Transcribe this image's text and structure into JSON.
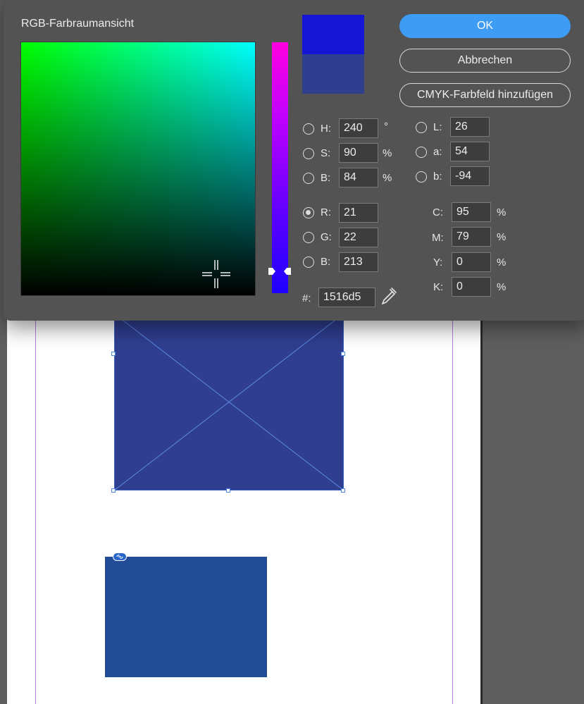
{
  "dialog": {
    "title": "RGB-Farbraumansicht",
    "ok_label": "OK",
    "cancel_label": "Abbrechen",
    "add_cmyk_label": "CMYK-Farbfeld hinzufügen"
  },
  "colors": {
    "new": "#1516d5",
    "previous": "#2f3e8f",
    "accent": "#3e9cf4"
  },
  "hsb": {
    "h": {
      "label": "H:",
      "value": "240",
      "unit": "°"
    },
    "s": {
      "label": "S:",
      "value": "90",
      "unit": "%"
    },
    "b": {
      "label": "B:",
      "value": "84",
      "unit": "%"
    }
  },
  "lab": {
    "l": {
      "label": "L:",
      "value": "26"
    },
    "a": {
      "label": "a:",
      "value": "54"
    },
    "b": {
      "label": "b:",
      "value": "-94"
    }
  },
  "rgb": {
    "r": {
      "label": "R:",
      "value": "21"
    },
    "g": {
      "label": "G:",
      "value": "22"
    },
    "b": {
      "label": "B:",
      "value": "213"
    }
  },
  "cmyk": {
    "c": {
      "label": "C:",
      "value": "95",
      "unit": "%"
    },
    "m": {
      "label": "M:",
      "value": "79",
      "unit": "%"
    },
    "y": {
      "label": "Y:",
      "value": "0",
      "unit": "%"
    },
    "k": {
      "label": "K:",
      "value": "0",
      "unit": "%"
    }
  },
  "hex": {
    "label": "#:",
    "value": "1516d5"
  },
  "icons": {
    "eyedropper": "eyedropper-icon",
    "link": "link-icon",
    "crosshair": "crosshair-icon"
  }
}
